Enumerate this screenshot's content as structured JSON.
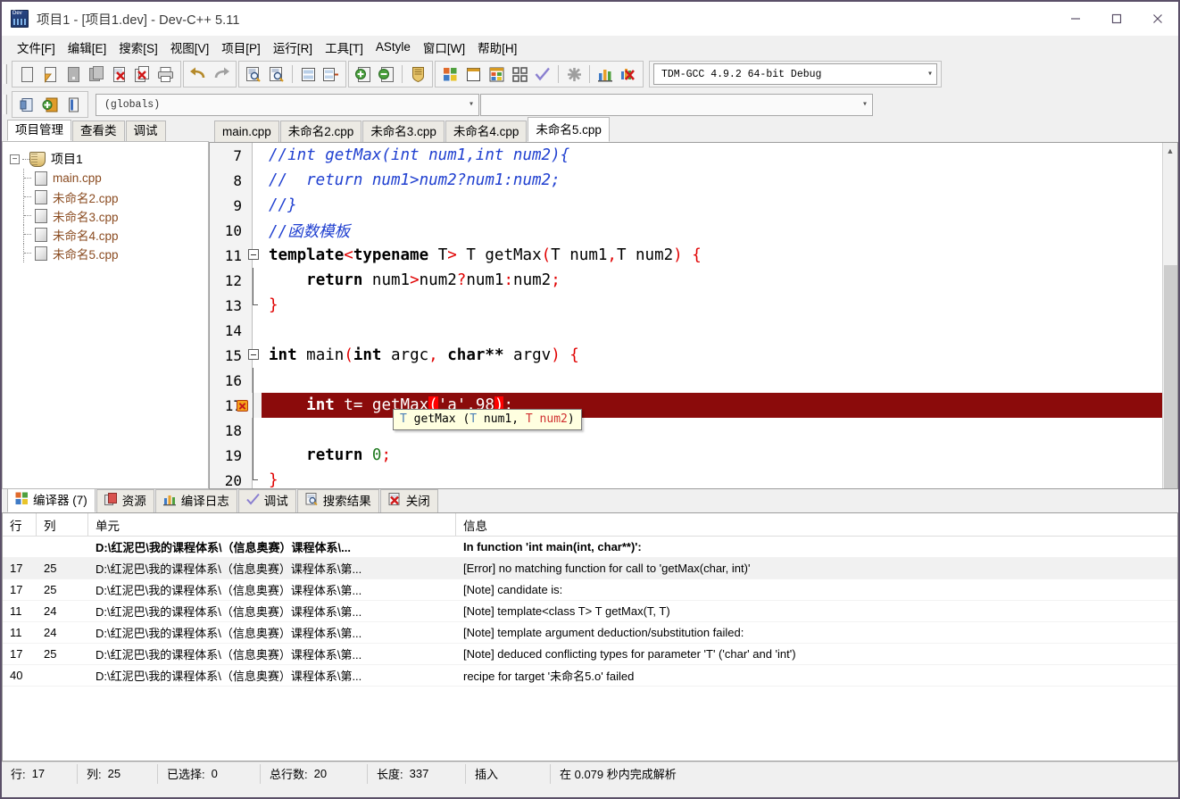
{
  "window": {
    "title": "项目1 - [项目1.dev] - Dev-C++ 5.11",
    "app_icon": "devcpp-icon",
    "minimize": "minimize-icon",
    "maximize": "maximize-icon",
    "close": "close-icon"
  },
  "menu": [
    {
      "label": "文件[F]",
      "name": "menu-file"
    },
    {
      "label": "编辑[E]",
      "name": "menu-edit"
    },
    {
      "label": "搜索[S]",
      "name": "menu-search"
    },
    {
      "label": "视图[V]",
      "name": "menu-view"
    },
    {
      "label": "项目[P]",
      "name": "menu-project"
    },
    {
      "label": "运行[R]",
      "name": "menu-run"
    },
    {
      "label": "工具[T]",
      "name": "menu-tools"
    },
    {
      "label": "AStyle",
      "name": "menu-astyle"
    },
    {
      "label": "窗口[W]",
      "name": "menu-window"
    },
    {
      "label": "帮助[H]",
      "name": "menu-help"
    }
  ],
  "toolbar": {
    "compiler_set": "TDM-GCC 4.9.2 64-bit Debug",
    "globals_combo": "(globals)",
    "members_combo": "",
    "icons": [
      "new-file-icon",
      "open-file-icon",
      "save-icon",
      "save-all-icon",
      "close-file-icon",
      "close-all-icon",
      "print-icon",
      "undo-icon",
      "redo-icon",
      "find-icon",
      "replace-icon",
      "goto-line-icon",
      "goto-function-icon",
      "add-to-project-icon",
      "remove-from-project-icon",
      "project-options-icon",
      "compile-icon",
      "run-icon",
      "compile-run-icon",
      "rebuild-all-icon",
      "syntax-check-icon",
      "stop-execution-icon",
      "profile-icon",
      "debug-icon"
    ],
    "icons_row2": [
      "new-project-icon",
      "insert-icon",
      "toggle-panel-icon"
    ]
  },
  "sidebar": {
    "tabs": [
      {
        "label": "项目管理",
        "active": true
      },
      {
        "label": "查看类",
        "active": false
      },
      {
        "label": "调试",
        "active": false
      }
    ],
    "tree": {
      "root": "项目1",
      "files": [
        "main.cpp",
        "未命名2.cpp",
        "未命名3.cpp",
        "未命名4.cpp",
        "未命名5.cpp"
      ]
    }
  },
  "editor": {
    "tabs": [
      {
        "label": "main.cpp",
        "active": false
      },
      {
        "label": "未命名2.cpp",
        "active": false
      },
      {
        "label": "未命名3.cpp",
        "active": false
      },
      {
        "label": "未命名4.cpp",
        "active": false
      },
      {
        "label": "未命名5.cpp",
        "active": true
      }
    ],
    "lines": [
      {
        "n": "7",
        "text": "//int getMax(int num1,int num2){"
      },
      {
        "n": "8",
        "text": "//  return num1>num2?num1:num2;"
      },
      {
        "n": "9",
        "text": "//}"
      },
      {
        "n": "10",
        "text": "//函数模板"
      },
      {
        "n": "11",
        "text": "template<typename T> T getMax(T num1,T num2) {"
      },
      {
        "n": "12",
        "text": "    return num1>num2?num1:num2;"
      },
      {
        "n": "13",
        "text": "}"
      },
      {
        "n": "14",
        "text": ""
      },
      {
        "n": "15",
        "text": "int main(int argc, char** argv) {"
      },
      {
        "n": "16",
        "text": ""
      },
      {
        "n": "17",
        "text": "    int t= getMax('a',98);"
      },
      {
        "n": "18",
        "text": ""
      },
      {
        "n": "19",
        "text": "    return 0;"
      },
      {
        "n": "20",
        "text": "}"
      }
    ],
    "error_line": "17",
    "error_marker": "error-bug-icon",
    "tooltip": "T getMax (T num1, T num2)",
    "colors": {
      "comment": "#2040d0",
      "keyword": "#000000",
      "operator": "#e00000",
      "number": "#1f7a1f",
      "error_line_bg": "#8b0b0b",
      "bracket_match_bg": "#ff0000"
    }
  },
  "bottom_panel": {
    "tabs": [
      {
        "label": "编译器 (7)",
        "icon": "compiler-icon",
        "active": true
      },
      {
        "label": "资源",
        "icon": "resource-icon",
        "active": false
      },
      {
        "label": "编译日志",
        "icon": "build-log-icon",
        "active": false
      },
      {
        "label": "调试",
        "icon": "debug-check-icon",
        "active": false
      },
      {
        "label": "搜索结果",
        "icon": "search-results-icon",
        "active": false
      },
      {
        "label": "关闭",
        "icon": "close-panel-icon",
        "active": false
      }
    ],
    "columns": [
      "行",
      "列",
      "单元",
      "信息"
    ],
    "rows": [
      {
        "line": "",
        "col": "",
        "unit": "D:\\红泥巴\\我的课程体系\\（信息奥赛）课程体系\\...",
        "message": "In function 'int main(int, char**)':",
        "bold": true,
        "highlight": false
      },
      {
        "line": "17",
        "col": "25",
        "unit": "D:\\红泥巴\\我的课程体系\\（信息奥赛）课程体系\\第...",
        "message": "[Error] no matching function for call to 'getMax(char, int)'",
        "bold": false,
        "highlight": true
      },
      {
        "line": "17",
        "col": "25",
        "unit": "D:\\红泥巴\\我的课程体系\\（信息奥赛）课程体系\\第...",
        "message": "[Note] candidate is:",
        "bold": false,
        "highlight": false
      },
      {
        "line": "11",
        "col": "24",
        "unit": "D:\\红泥巴\\我的课程体系\\（信息奥赛）课程体系\\第...",
        "message": "[Note] template<class T> T getMax(T, T)",
        "bold": false,
        "highlight": false
      },
      {
        "line": "11",
        "col": "24",
        "unit": "D:\\红泥巴\\我的课程体系\\（信息奥赛）课程体系\\第...",
        "message": "[Note] template argument deduction/substitution failed:",
        "bold": false,
        "highlight": false
      },
      {
        "line": "17",
        "col": "25",
        "unit": "D:\\红泥巴\\我的课程体系\\（信息奥赛）课程体系\\第...",
        "message": "[Note] deduced conflicting types for parameter 'T' ('char' and 'int')",
        "bold": false,
        "highlight": false
      },
      {
        "line": "40",
        "col": "",
        "unit": "D:\\红泥巴\\我的课程体系\\（信息奥赛）课程体系\\第...",
        "message": "recipe for target '未命名5.o' failed",
        "bold": false,
        "highlight": false
      }
    ]
  },
  "status_bar": {
    "row_label": "行:",
    "row_value": "17",
    "col_label": "列:",
    "col_value": "25",
    "sel_label": "已选择:",
    "sel_value": "0",
    "total_label": "总行数:",
    "total_value": "20",
    "len_label": "长度:",
    "len_value": "337",
    "mode": "插入",
    "parse": "在 0.079 秒内完成解析"
  }
}
